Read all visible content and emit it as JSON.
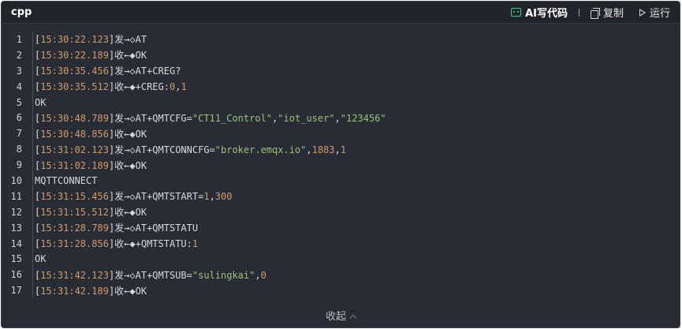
{
  "header": {
    "language": "cpp",
    "ai_label": "AI写代码",
    "copy_label": "复制",
    "run_label": "运行"
  },
  "lines": [
    {
      "num": "1",
      "parts": [
        [
          "br",
          "["
        ],
        [
          "ts",
          "15:30:22.123"
        ],
        [
          "br",
          "]"
        ],
        [
          "txt",
          "发→◇AT"
        ]
      ]
    },
    {
      "num": "2",
      "parts": [
        [
          "br",
          "["
        ],
        [
          "ts",
          "15:30:22.189"
        ],
        [
          "br",
          "]"
        ],
        [
          "txt",
          "收←◆OK"
        ]
      ]
    },
    {
      "num": "3",
      "parts": [
        [
          "br",
          "["
        ],
        [
          "ts",
          "15:30:35.456"
        ],
        [
          "br",
          "]"
        ],
        [
          "txt",
          "发→◇AT+CREG?"
        ]
      ]
    },
    {
      "num": "4",
      "parts": [
        [
          "br",
          "["
        ],
        [
          "ts",
          "15:30:35.512"
        ],
        [
          "br",
          "]"
        ],
        [
          "txt",
          "收←◆+CREG:"
        ],
        [
          "num",
          "0"
        ],
        [
          "txt",
          ","
        ],
        [
          "num",
          "1"
        ]
      ]
    },
    {
      "num": "5",
      "parts": [
        [
          "txt",
          "OK"
        ]
      ]
    },
    {
      "num": "6",
      "parts": [
        [
          "br",
          "["
        ],
        [
          "ts",
          "15:30:48.789"
        ],
        [
          "br",
          "]"
        ],
        [
          "txt",
          "发→◇AT+QMTCFG="
        ],
        [
          "str",
          "\"CT11_Control\""
        ],
        [
          "txt",
          ","
        ],
        [
          "str",
          "\"iot_user\""
        ],
        [
          "txt",
          ","
        ],
        [
          "str",
          "\"123456\""
        ]
      ]
    },
    {
      "num": "7",
      "parts": [
        [
          "br",
          "["
        ],
        [
          "ts",
          "15:30:48.856"
        ],
        [
          "br",
          "]"
        ],
        [
          "txt",
          "收←◆OK"
        ]
      ]
    },
    {
      "num": "8",
      "parts": [
        [
          "br",
          "["
        ],
        [
          "ts",
          "15:31:02.123"
        ],
        [
          "br",
          "]"
        ],
        [
          "txt",
          "发→◇AT+QMTCONNCFG="
        ],
        [
          "str",
          "\"broker.emqx.io\""
        ],
        [
          "txt",
          ","
        ],
        [
          "num",
          "1883"
        ],
        [
          "txt",
          ","
        ],
        [
          "num",
          "1"
        ]
      ]
    },
    {
      "num": "9",
      "parts": [
        [
          "br",
          "["
        ],
        [
          "ts",
          "15:31:02.189"
        ],
        [
          "br",
          "]"
        ],
        [
          "txt",
          "收←◆OK"
        ]
      ]
    },
    {
      "num": "10",
      "parts": [
        [
          "txt",
          "MQTTCONNECT"
        ]
      ]
    },
    {
      "num": "11",
      "parts": [
        [
          "br",
          "["
        ],
        [
          "ts",
          "15:31:15.456"
        ],
        [
          "br",
          "]"
        ],
        [
          "txt",
          "发→◇AT+QMTSTART="
        ],
        [
          "num",
          "1"
        ],
        [
          "txt",
          ","
        ],
        [
          "num",
          "300"
        ]
      ]
    },
    {
      "num": "12",
      "parts": [
        [
          "br",
          "["
        ],
        [
          "ts",
          "15:31:15.512"
        ],
        [
          "br",
          "]"
        ],
        [
          "txt",
          "收←◆OK"
        ]
      ]
    },
    {
      "num": "13",
      "parts": [
        [
          "br",
          "["
        ],
        [
          "ts",
          "15:31:28.789"
        ],
        [
          "br",
          "]"
        ],
        [
          "txt",
          "发→◇AT+QMTSTATU"
        ]
      ]
    },
    {
      "num": "14",
      "parts": [
        [
          "br",
          "["
        ],
        [
          "ts",
          "15:31:28.856"
        ],
        [
          "br",
          "]"
        ],
        [
          "txt",
          "收←◆+QMTSTATU:"
        ],
        [
          "num",
          "1"
        ]
      ]
    },
    {
      "num": "15",
      "parts": [
        [
          "txt",
          "OK"
        ]
      ]
    },
    {
      "num": "16",
      "parts": [
        [
          "br",
          "["
        ],
        [
          "ts",
          "15:31:42.123"
        ],
        [
          "br",
          "]"
        ],
        [
          "txt",
          "发→◇AT+QMTSUB="
        ],
        [
          "str",
          "\"sulingkai\""
        ],
        [
          "txt",
          ","
        ],
        [
          "num",
          "0"
        ]
      ]
    },
    {
      "num": "17",
      "parts": [
        [
          "br",
          "["
        ],
        [
          "ts",
          "15:31:42.189"
        ],
        [
          "br",
          "]"
        ],
        [
          "txt",
          "收←◆OK"
        ]
      ]
    }
  ],
  "footer": {
    "collapse_label": "收起"
  },
  "colors": {
    "background": "#282c34",
    "timestamp": "#d19a66",
    "string": "#98c379",
    "ai_accent": "#3ccf6e"
  }
}
